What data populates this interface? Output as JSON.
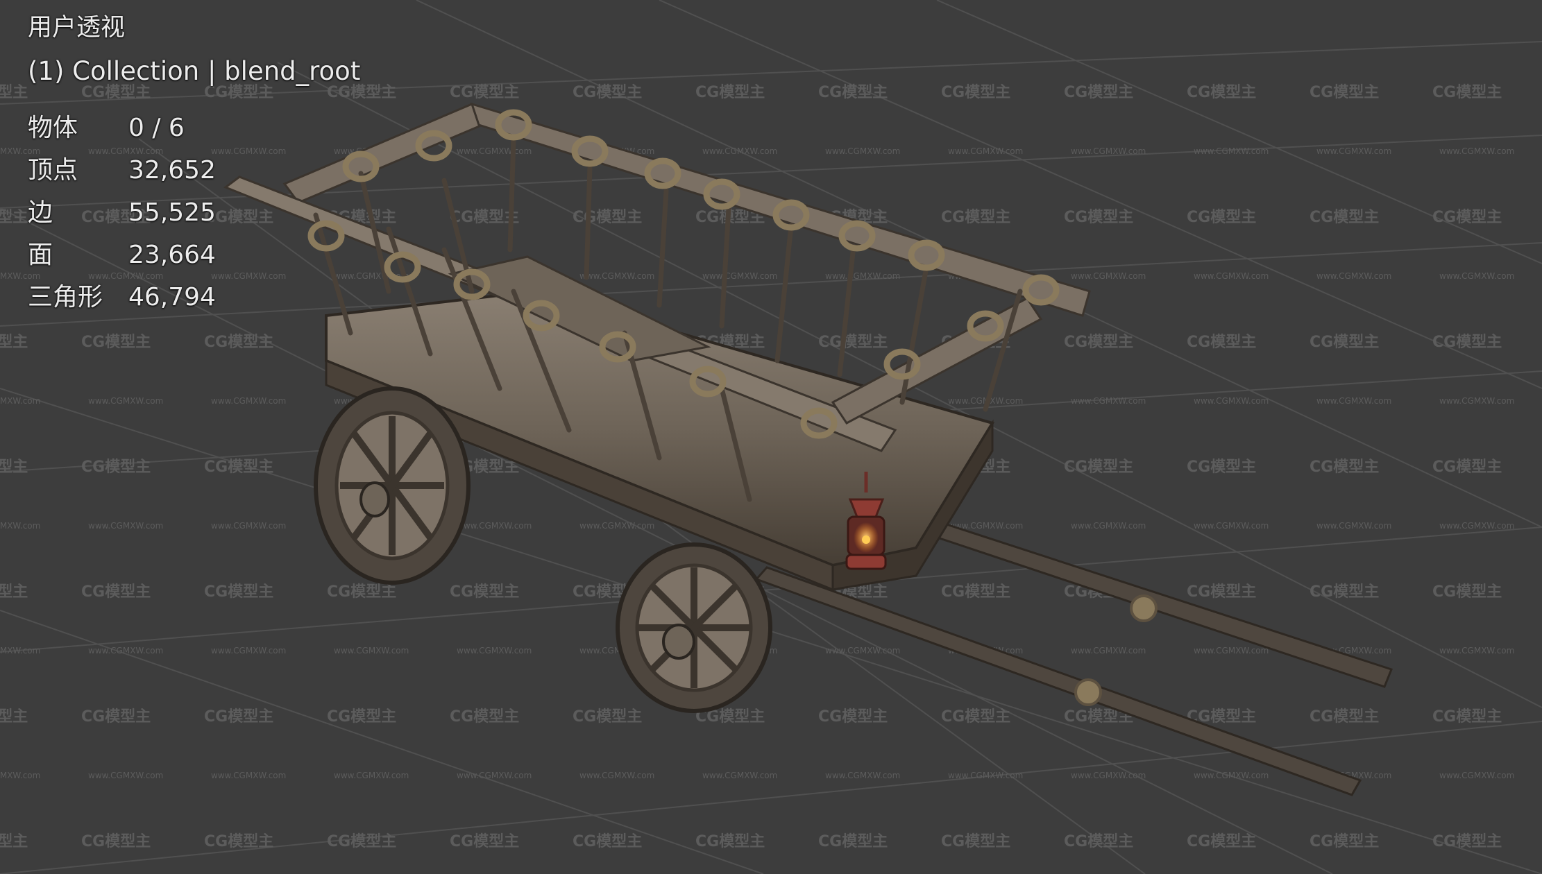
{
  "viewport": {
    "view_name": "用户透视",
    "collection": "(1) Collection | blend_root",
    "stats": [
      {
        "label": "物体",
        "value": "0 / 6"
      },
      {
        "label": "顶点",
        "value": "32,652"
      },
      {
        "label": "边",
        "value": "55,525"
      },
      {
        "label": "面",
        "value": "23,664"
      },
      {
        "label": "三角形",
        "value": "46,794"
      }
    ]
  },
  "watermark": {
    "text": "CG模型主",
    "url": "www.CGMXW.com"
  },
  "colors": {
    "background": "#3d3d3d",
    "grid": "#4f4f4f",
    "wood": "#6f655a",
    "wood_dark": "#3b342d",
    "rope": "#8a7a5c",
    "lantern": "#8e3b33",
    "lantern_glow": "#ffae3a"
  }
}
